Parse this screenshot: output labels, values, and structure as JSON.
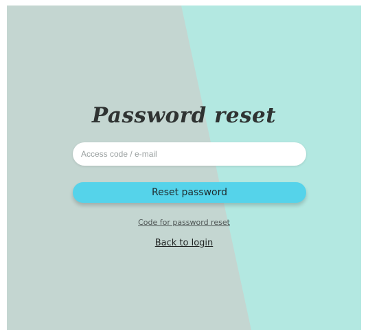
{
  "page": {
    "title": "Password reset"
  },
  "form": {
    "email_placeholder": "Access code / e-mail",
    "reset_label": "Reset password"
  },
  "links": {
    "code_label": "Code for password reset",
    "back_label": "Back to login"
  },
  "colors": {
    "left_background": "#c4d6d1",
    "right_background": "#b3e8e1",
    "button": "#55d3ea",
    "heading": "#2f3332"
  }
}
